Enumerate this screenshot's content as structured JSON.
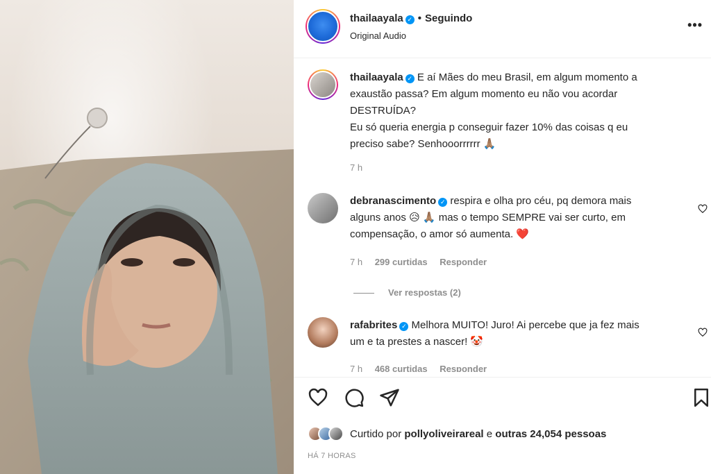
{
  "header": {
    "username": "thailaayala",
    "separator": "•",
    "follow_status": "Seguindo",
    "audio": "Original Audio",
    "more": "•••"
  },
  "caption": {
    "username": "thailaayala",
    "lines": [
      "E aí Mães do meu Brasil, em algum momento a",
      "exaustão passa? Em algum momento eu não vou acordar",
      "DESTRUÍDA?",
      "Eu só queria energia p conseguir fazer 10% das coisas q eu",
      "preciso sabe? Senhooorrrrrr 🙏🏽"
    ],
    "time": "7 h"
  },
  "comments": [
    {
      "username": "debranascimento",
      "lines": [
        "respira e olha pro céu, pq demora mais",
        "alguns anos 😥 🙏🏽 mas o tempo SEMPRE vai ser curto, em",
        "compensação, o amor só aumenta. ❤️"
      ],
      "time": "7 h",
      "likes": "299 curtidas",
      "reply": "Responder",
      "view_replies": "Ver respostas (2)"
    },
    {
      "username": "rafabrites",
      "lines": [
        "Melhora MUITO! Juro! Ai percebe que ja fez mais",
        "um e ta prestes a nascer! 🤡"
      ],
      "time": "7 h",
      "likes": "468 curtidas",
      "reply": "Responder"
    }
  ],
  "likes_bar": {
    "prefix": "Curtido por",
    "user": "pollyoliveirareal",
    "middle": "e",
    "others": "outras 24,054 pessoas"
  },
  "timestamp": "HÁ 7 HORAS",
  "icons": {
    "like": "heart-icon",
    "comment": "comment-icon",
    "share": "send-icon",
    "save": "bookmark-icon",
    "verified": "verified-badge-icon"
  },
  "colors": {
    "verified": "#0095f6",
    "muted": "#8e8e8e",
    "text": "#262626"
  }
}
